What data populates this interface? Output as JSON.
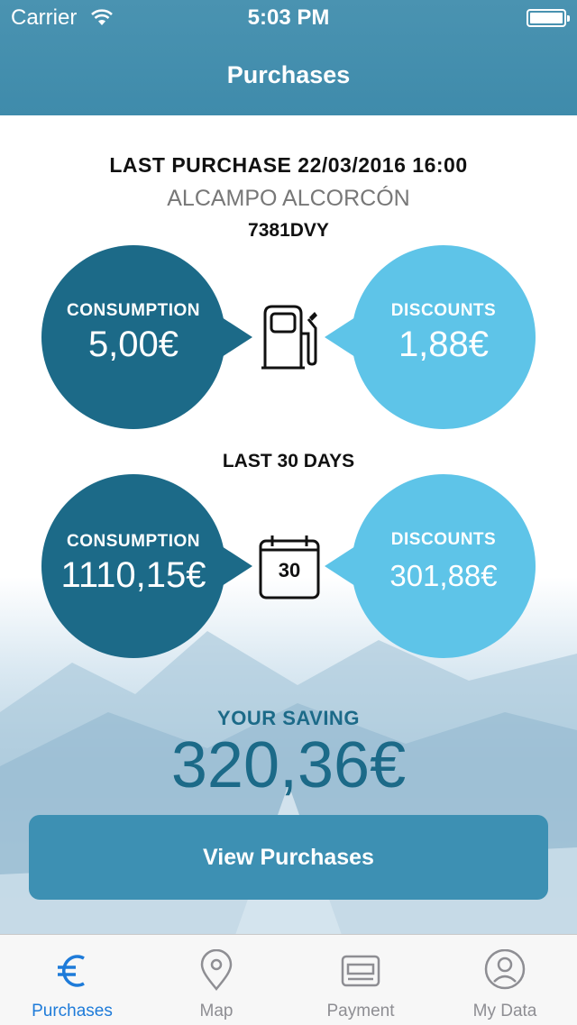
{
  "status_bar": {
    "carrier": "Carrier",
    "time": "5:03 PM"
  },
  "nav": {
    "title": "Purchases"
  },
  "last_purchase": {
    "heading": "LAST PURCHASE 22/03/2016 16:00",
    "station": "ALCAMPO ALCORCÓN",
    "plate": "7381DVY",
    "consumption_label": "CONSUMPTION",
    "consumption_value": "5,00€",
    "discounts_label": "DISCOUNTS",
    "discounts_value": "1,88€"
  },
  "last_30_days": {
    "heading": "LAST 30 DAYS",
    "consumption_label": "CONSUMPTION",
    "consumption_value": "1110,15€",
    "discounts_label": "DISCOUNTS",
    "discounts_value": "301,88€",
    "calendar_number": "30"
  },
  "saving": {
    "label": "YOUR SAVING",
    "value": "320,36€"
  },
  "view_button": {
    "label": "View Purchases"
  },
  "tabs": [
    {
      "label": "Purchases",
      "icon": "euro-icon",
      "active": true
    },
    {
      "label": "Map",
      "icon": "map-pin-icon",
      "active": false
    },
    {
      "label": "Payment",
      "icon": "card-icon",
      "active": false
    },
    {
      "label": "My Data",
      "icon": "user-icon",
      "active": false
    }
  ],
  "colors": {
    "header": "#4a93b1",
    "dark_circle": "#1c6a88",
    "light_circle": "#5ec4e8",
    "button": "#3d90b3",
    "active_tab": "#1e7bd9"
  }
}
